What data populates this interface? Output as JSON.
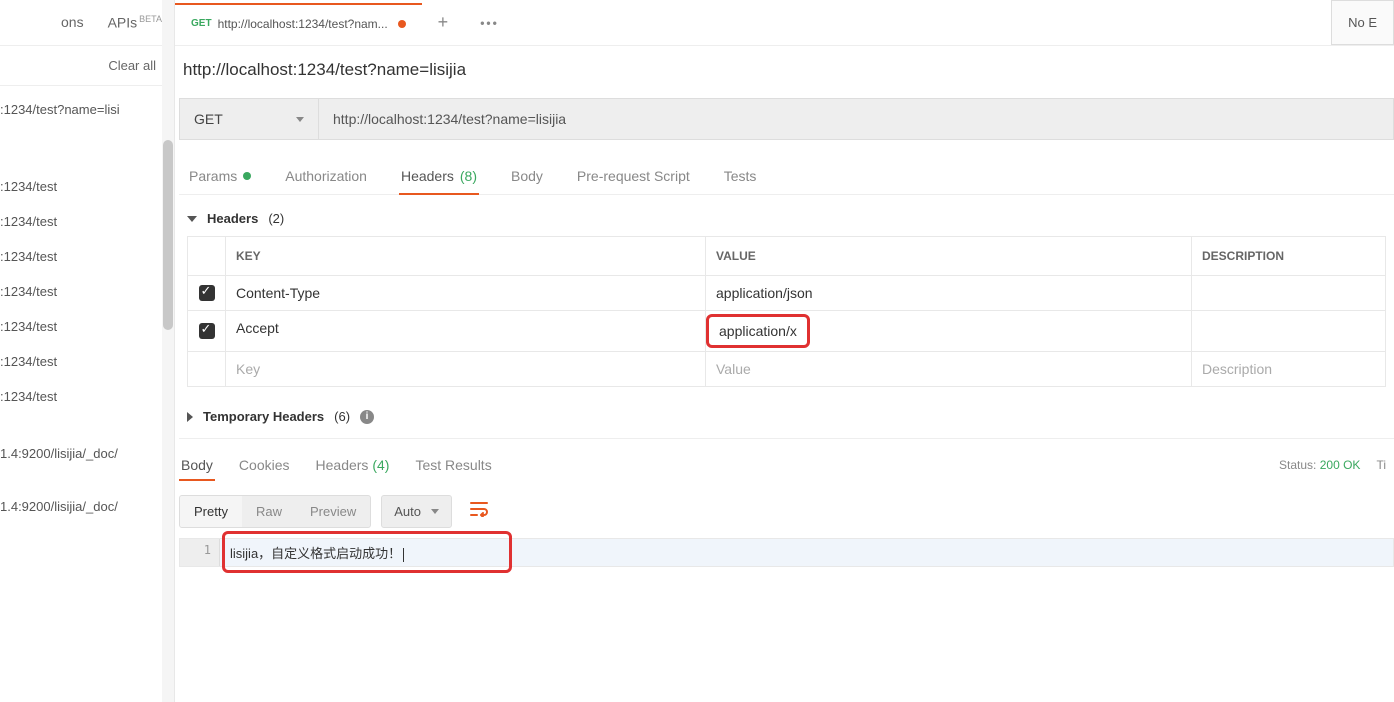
{
  "sidebar": {
    "nav": {
      "collections": "ons",
      "apis": "APIs",
      "beta_badge": "BETA"
    },
    "clear_all": "Clear all",
    "history": [
      ":1234/test?name=lisi",
      ":1234/test",
      ":1234/test",
      ":1234/test",
      ":1234/test",
      ":1234/test",
      ":1234/test",
      ":1234/test",
      "1.4:9200/lisijia/_doc/",
      "1.4:9200/lisijia/_doc/"
    ]
  },
  "tab": {
    "method": "GET",
    "title": "http://localhost:1234/test?nam..."
  },
  "right_badge": "No E",
  "request": {
    "title": "http://localhost:1234/test?name=lisijia",
    "method": "GET",
    "url": "http://localhost:1234/test?name=lisijia",
    "tabs": {
      "params": "Params",
      "authorization": "Authorization",
      "headers": "Headers",
      "headers_count": "(8)",
      "body": "Body",
      "prerequest": "Pre-request Script",
      "tests": "Tests"
    }
  },
  "headers_section": {
    "title": "Headers",
    "count": "(2)",
    "columns": {
      "key": "KEY",
      "value": "VALUE",
      "description": "DESCRIPTION"
    },
    "rows": [
      {
        "key": "Content-Type",
        "value": "application/json"
      },
      {
        "key": "Accept",
        "value": "application/x"
      }
    ],
    "placeholder": {
      "key": "Key",
      "value": "Value",
      "description": "Description"
    },
    "temp_title": "Temporary Headers",
    "temp_count": "(6)"
  },
  "response": {
    "tabs": {
      "body": "Body",
      "cookies": "Cookies",
      "headers": "Headers",
      "headers_count": "(4)",
      "test_results": "Test Results"
    },
    "status_label": "Status:",
    "status_value": "200 OK",
    "time_label": "Ti",
    "toolbar": {
      "pretty": "Pretty",
      "raw": "Raw",
      "preview": "Preview",
      "auto": "Auto"
    },
    "body_line_num": "1",
    "body_text": "lisijia，自定义格式启动成功！"
  }
}
